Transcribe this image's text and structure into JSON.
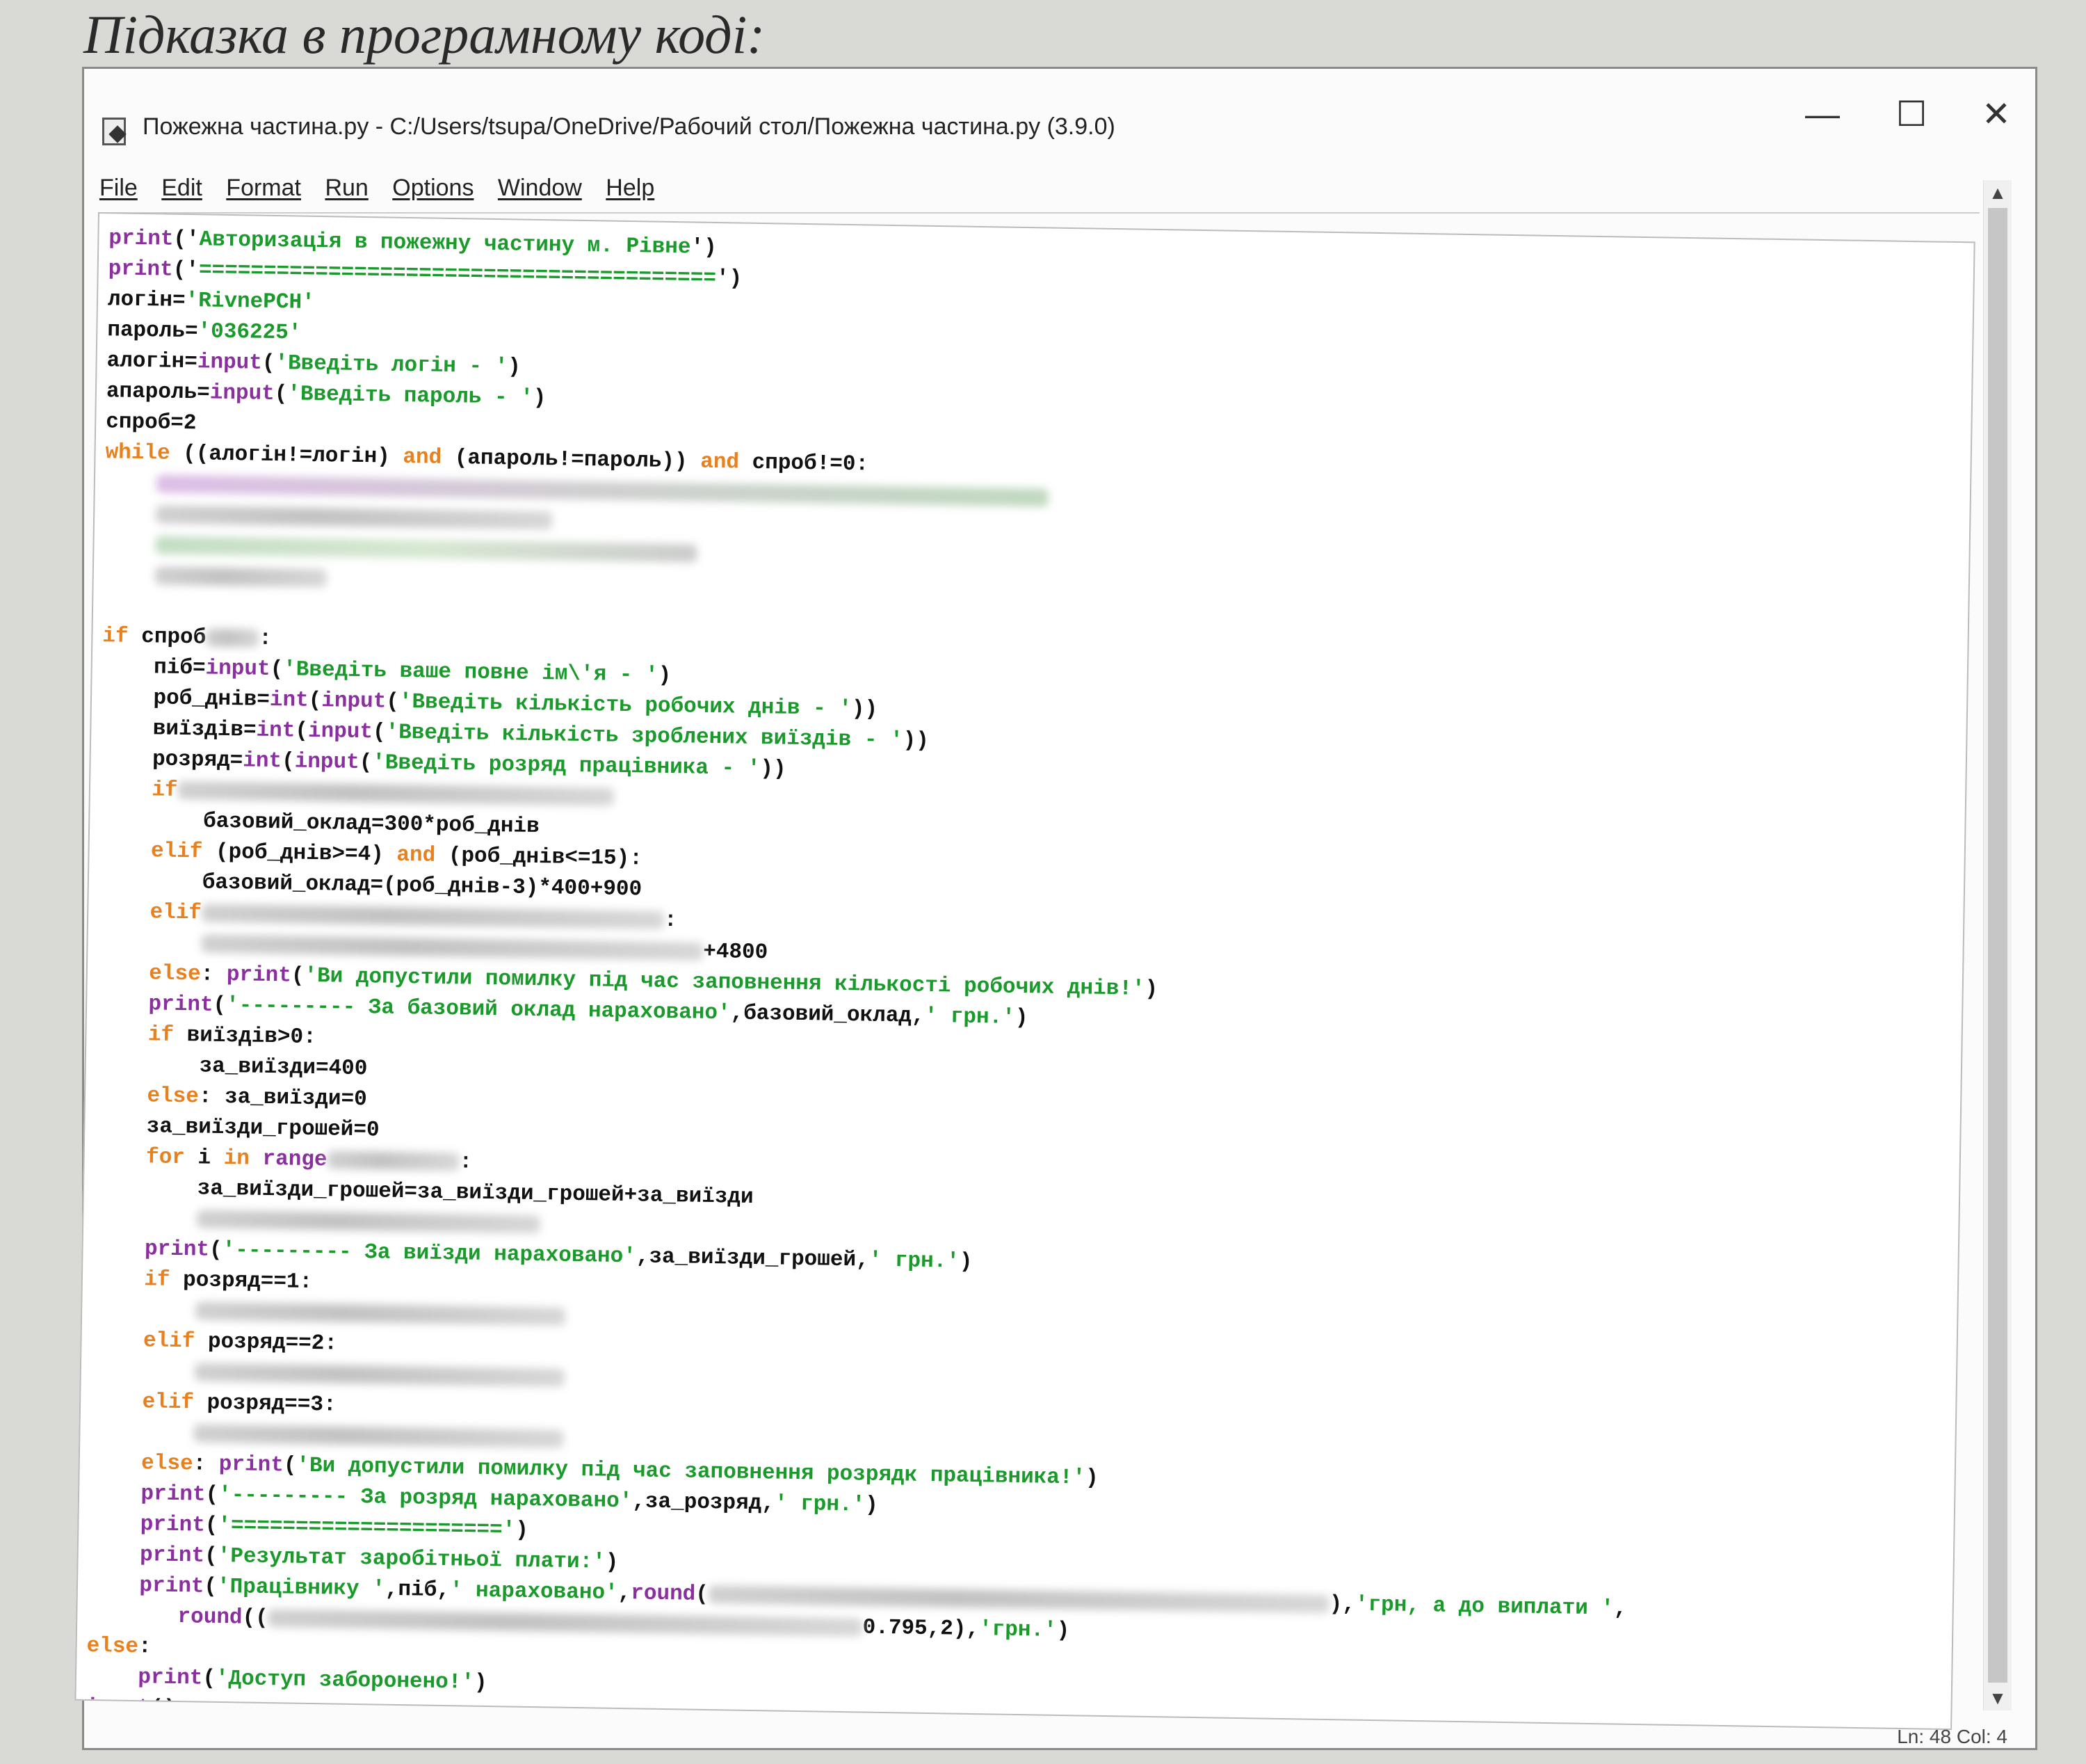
{
  "heading": "Підказка в програмному коді:",
  "window": {
    "title": "Пожежна частина.py - C:/Users/tsupa/OneDrive/Рабочий стол/Пожежна частина.py (3.9.0)",
    "controls": {
      "minimize": "—",
      "maximize": "☐",
      "close": "✕"
    }
  },
  "menu": [
    "File",
    "Edit",
    "Format",
    "Run",
    "Options",
    "Window",
    "Help"
  ],
  "status": "Ln: 48   Col: 4",
  "code": [
    {
      "indent": 0,
      "parts": [
        {
          "t": "print",
          "c": "bi"
        },
        {
          "t": "('"
        },
        {
          "t": "Авторизація в пожежну частину м. Рівне",
          "c": "st"
        },
        {
          "t": "')"
        }
      ]
    },
    {
      "indent": 0,
      "parts": [
        {
          "t": "print",
          "c": "bi"
        },
        {
          "t": "('"
        },
        {
          "t": "========================================",
          "c": "st"
        },
        {
          "t": "')"
        }
      ]
    },
    {
      "indent": 0,
      "parts": [
        {
          "t": "логін="
        },
        {
          "t": "'RivnePCH'",
          "c": "st"
        }
      ]
    },
    {
      "indent": 0,
      "parts": [
        {
          "t": "пароль="
        },
        {
          "t": "'036225'",
          "c": "st"
        }
      ]
    },
    {
      "indent": 0,
      "parts": [
        {
          "t": "алогін="
        },
        {
          "t": "input",
          "c": "bi"
        },
        {
          "t": "("
        },
        {
          "t": "'Введіть логін - '",
          "c": "st"
        },
        {
          "t": ")"
        }
      ]
    },
    {
      "indent": 0,
      "parts": [
        {
          "t": "апароль="
        },
        {
          "t": "input",
          "c": "bi"
        },
        {
          "t": "("
        },
        {
          "t": "'Введіть пароль - '",
          "c": "st"
        },
        {
          "t": ")"
        }
      ]
    },
    {
      "indent": 0,
      "parts": [
        {
          "t": "спроб=2"
        }
      ]
    },
    {
      "indent": 0,
      "parts": [
        {
          "t": "while",
          "c": "kw"
        },
        {
          "t": " ((алогін!=логін) "
        },
        {
          "t": "and",
          "c": "kw"
        },
        {
          "t": " (апароль!=пароль)) "
        },
        {
          "t": "and",
          "c": "kw"
        },
        {
          "t": " спроб!=0:"
        }
      ]
    },
    {
      "indent": 4,
      "parts": [
        {
          "blur": 1350,
          "c": "purple"
        }
      ]
    },
    {
      "indent": 4,
      "parts": [
        {
          "blur": 600
        }
      ]
    },
    {
      "indent": 4,
      "parts": [
        {
          "blur": 820,
          "c": "green"
        }
      ]
    },
    {
      "indent": 4,
      "parts": [
        {
          "blur": 260
        }
      ]
    },
    {
      "indent": 0,
      "parts": []
    },
    {
      "indent": 0,
      "parts": [
        {
          "t": "if",
          "c": "kw"
        },
        {
          "t": " спроб"
        },
        {
          "blur": 80
        },
        {
          "t": ":"
        }
      ]
    },
    {
      "indent": 4,
      "parts": [
        {
          "t": "піб="
        },
        {
          "t": "input",
          "c": "bi"
        },
        {
          "t": "("
        },
        {
          "t": "'Введіть ваше повне ім\\'я - '",
          "c": "st"
        },
        {
          "t": ")"
        }
      ]
    },
    {
      "indent": 4,
      "parts": [
        {
          "t": "роб_днів="
        },
        {
          "t": "int",
          "c": "bi"
        },
        {
          "t": "("
        },
        {
          "t": "input",
          "c": "bi"
        },
        {
          "t": "("
        },
        {
          "t": "'Введіть кількість робочих днів - '",
          "c": "st"
        },
        {
          "t": "))"
        }
      ]
    },
    {
      "indent": 4,
      "parts": [
        {
          "t": "виїздів="
        },
        {
          "t": "int",
          "c": "bi"
        },
        {
          "t": "("
        },
        {
          "t": "input",
          "c": "bi"
        },
        {
          "t": "("
        },
        {
          "t": "'Введіть кількість зроблених виїздів - '",
          "c": "st"
        },
        {
          "t": "))"
        }
      ]
    },
    {
      "indent": 4,
      "parts": [
        {
          "t": "розряд="
        },
        {
          "t": "int",
          "c": "bi"
        },
        {
          "t": "("
        },
        {
          "t": "input",
          "c": "bi"
        },
        {
          "t": "("
        },
        {
          "t": "'Введіть розряд працівника - '",
          "c": "st"
        },
        {
          "t": "))"
        }
      ]
    },
    {
      "indent": 4,
      "parts": [
        {
          "t": "if",
          "c": "kw"
        },
        {
          "blur": 660
        }
      ]
    },
    {
      "indent": 8,
      "parts": [
        {
          "t": "базовий_оклад=300*роб_днів"
        }
      ]
    },
    {
      "indent": 4,
      "parts": [
        {
          "t": "elif",
          "c": "kw"
        },
        {
          "t": " (роб_днів>=4) "
        },
        {
          "t": "and",
          "c": "kw"
        },
        {
          "t": " (роб_днів<=15):"
        }
      ]
    },
    {
      "indent": 8,
      "parts": [
        {
          "t": "базовий_оклад=(роб_днів-3)*400+900"
        }
      ]
    },
    {
      "indent": 4,
      "parts": [
        {
          "t": "elif",
          "c": "kw"
        },
        {
          "blur": 700
        },
        {
          "t": ":"
        }
      ]
    },
    {
      "indent": 8,
      "parts": [
        {
          "blur": 760
        },
        {
          "t": "+4800"
        }
      ]
    },
    {
      "indent": 4,
      "parts": [
        {
          "t": "else",
          "c": "kw"
        },
        {
          "t": ": "
        },
        {
          "t": "print",
          "c": "bi"
        },
        {
          "t": "("
        },
        {
          "t": "'Ви допустили помилку під час заповнення кількості робочих днів!'",
          "c": "st"
        },
        {
          "t": ")"
        }
      ]
    },
    {
      "indent": 4,
      "parts": [
        {
          "t": "print",
          "c": "bi"
        },
        {
          "t": "("
        },
        {
          "t": "'--------- За базовий оклад нараховано'",
          "c": "st"
        },
        {
          "t": ",базовий_оклад,"
        },
        {
          "t": "' грн.'",
          "c": "st"
        },
        {
          "t": ")"
        }
      ]
    },
    {
      "indent": 4,
      "parts": [
        {
          "t": "if",
          "c": "kw"
        },
        {
          "t": " виїздів>0:"
        }
      ]
    },
    {
      "indent": 8,
      "parts": [
        {
          "t": "за_виїзди=400"
        }
      ]
    },
    {
      "indent": 4,
      "parts": [
        {
          "t": "else",
          "c": "kw"
        },
        {
          "t": ": за_виїзди=0"
        }
      ]
    },
    {
      "indent": 4,
      "parts": [
        {
          "t": "за_виїзди_грошей=0"
        }
      ]
    },
    {
      "indent": 4,
      "parts": [
        {
          "t": "for",
          "c": "kw"
        },
        {
          "t": " i "
        },
        {
          "t": "in",
          "c": "kw"
        },
        {
          "t": " "
        },
        {
          "t": "range",
          "c": "bi"
        },
        {
          "blur": 200
        },
        {
          "t": ":"
        }
      ]
    },
    {
      "indent": 8,
      "parts": [
        {
          "t": "за_виїзди_грошей=за_виїзди_грошей+за_виїзди"
        }
      ]
    },
    {
      "indent": 8,
      "parts": [
        {
          "blur": 520
        }
      ]
    },
    {
      "indent": 4,
      "parts": [
        {
          "t": "print",
          "c": "bi"
        },
        {
          "t": "("
        },
        {
          "t": "'--------- За виїзди нараховано'",
          "c": "st"
        },
        {
          "t": ",за_виїзди_грошей,"
        },
        {
          "t": "' грн.'",
          "c": "st"
        },
        {
          "t": ")"
        }
      ]
    },
    {
      "indent": 4,
      "parts": [
        {
          "t": "if",
          "c": "kw"
        },
        {
          "t": " розряд==1:"
        }
      ]
    },
    {
      "indent": 8,
      "parts": [
        {
          "blur": 560
        }
      ]
    },
    {
      "indent": 4,
      "parts": [
        {
          "t": "elif",
          "c": "kw"
        },
        {
          "t": " розряд==2:"
        }
      ]
    },
    {
      "indent": 8,
      "parts": [
        {
          "blur": 560
        }
      ]
    },
    {
      "indent": 4,
      "parts": [
        {
          "t": "elif",
          "c": "kw"
        },
        {
          "t": " розряд==3:"
        }
      ]
    },
    {
      "indent": 8,
      "parts": [
        {
          "blur": 560
        }
      ]
    },
    {
      "indent": 4,
      "parts": [
        {
          "t": "else",
          "c": "kw"
        },
        {
          "t": ": "
        },
        {
          "t": "print",
          "c": "bi"
        },
        {
          "t": "("
        },
        {
          "t": "'Ви допустили помилку під час заповнення розрядк працівника!'",
          "c": "st"
        },
        {
          "t": ")"
        }
      ]
    },
    {
      "indent": 4,
      "parts": [
        {
          "t": "print",
          "c": "bi"
        },
        {
          "t": "("
        },
        {
          "t": "'--------- За розряд нараховано'",
          "c": "st"
        },
        {
          "t": ",за_розряд,"
        },
        {
          "t": "' грн.'",
          "c": "st"
        },
        {
          "t": ")"
        }
      ]
    },
    {
      "indent": 4,
      "parts": [
        {
          "t": "print",
          "c": "bi"
        },
        {
          "t": "("
        },
        {
          "t": "'====================='",
          "c": "st"
        },
        {
          "t": ")"
        }
      ]
    },
    {
      "indent": 4,
      "parts": [
        {
          "t": "print",
          "c": "bi"
        },
        {
          "t": "("
        },
        {
          "t": "'Результат заробітньої плати:'",
          "c": "st"
        },
        {
          "t": ")"
        }
      ]
    },
    {
      "indent": 4,
      "parts": [
        {
          "t": "print",
          "c": "bi"
        },
        {
          "t": "("
        },
        {
          "t": "'Працівнику '",
          "c": "st"
        },
        {
          "t": ",піб,"
        },
        {
          "t": "' нараховано'",
          "c": "st"
        },
        {
          "t": ","
        },
        {
          "t": "round",
          "c": "bi"
        },
        {
          "t": "("
        },
        {
          "blur": 940
        },
        {
          "t": "),"
        },
        {
          "t": "'грн, а до виплати '",
          "c": "st"
        },
        {
          "t": ","
        }
      ]
    },
    {
      "indent": 7,
      "parts": [
        {
          "t": "round",
          "c": "bi"
        },
        {
          "t": "(("
        },
        {
          "blur": 900
        },
        {
          "t": "0.795,2),"
        },
        {
          "t": "'грн.'",
          "c": "st"
        },
        {
          "t": ")"
        }
      ]
    },
    {
      "indent": 0,
      "parts": [
        {
          "t": "else",
          "c": "kw"
        },
        {
          "t": ":"
        }
      ]
    },
    {
      "indent": 4,
      "parts": [
        {
          "t": "print",
          "c": "bi"
        },
        {
          "t": "("
        },
        {
          "t": "'Доступ заборонено!'",
          "c": "st"
        },
        {
          "t": ")"
        }
      ]
    },
    {
      "indent": 0,
      "parts": [
        {
          "t": "input",
          "c": "bi"
        },
        {
          "t": "()"
        }
      ]
    },
    {
      "indent": 0,
      "parts": [
        {
          "cursor": true
        }
      ]
    }
  ]
}
